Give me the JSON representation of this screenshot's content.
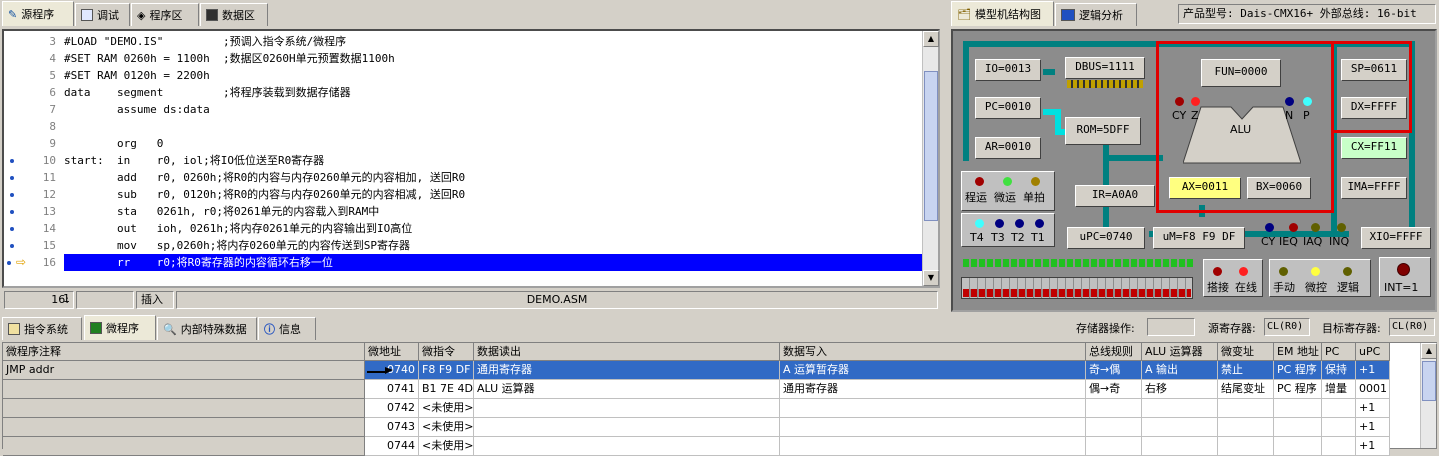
{
  "top_tabs": [
    "源程序",
    "调试",
    "程序区",
    "数据区"
  ],
  "right_tabs": [
    "模型机结构图",
    "逻辑分析"
  ],
  "product": "产品型号: Dais-CMX16+  外部总线: 16-bit",
  "editor": {
    "lines": [
      {
        "n": "3",
        "text": "#LOAD \"DEMO.IS\"         ;预调入指令系统/微程序",
        "marker": ""
      },
      {
        "n": "4",
        "text": "#SET RAM 0260h = 1100h  ;数据区0260H单元预置数据1100h",
        "marker": ""
      },
      {
        "n": "5",
        "text": "#SET RAM 0120h = 2200h",
        "marker": ""
      },
      {
        "n": "6",
        "text": "data    segment         ;将程序装载到数据存储器",
        "marker": ""
      },
      {
        "n": "7",
        "text": "        assume ds:data",
        "marker": ""
      },
      {
        "n": "8",
        "text": "",
        "marker": ""
      },
      {
        "n": "9",
        "text": "        org   0",
        "marker": ""
      },
      {
        "n": "10",
        "text": "start:  in    r0, iol;将IO低位送至R0寄存器",
        "marker": "dot"
      },
      {
        "n": "11",
        "text": "        add   r0, 0260h;将R0的内容与内存0260单元的内容相加, 送回R0",
        "marker": "dot"
      },
      {
        "n": "12",
        "text": "        sub   r0, 0120h;将R0的内容与内存0260单元的内容相减, 送回R0",
        "marker": "dot"
      },
      {
        "n": "13",
        "text": "        sta   0261h, r0;将0261单元的内容载入到RAM中",
        "marker": "dot"
      },
      {
        "n": "14",
        "text": "        out   ioh, 0261h;将内存0261单元的内容输出到IO高位",
        "marker": "dot"
      },
      {
        "n": "15",
        "text": "        mov   sp,0260h;将内存0260单元的内容传送到SP寄存器",
        "marker": "dot"
      },
      {
        "n": "16",
        "text": "        rr    r0;将R0寄存器的内容循环右移一位",
        "marker": "current"
      }
    ]
  },
  "status": {
    "pos1": "16:",
    "pos2": "1",
    "mode": "插入",
    "file": "DEMO.ASM"
  },
  "model": {
    "io": "IO=0013",
    "pc": "PC=0010",
    "ar": "AR=0010",
    "dbus": "DBUS=1111",
    "rom": "ROM=5DFF",
    "fun": "FUN=0000",
    "alu": "ALU",
    "ax": "AX=0011",
    "bx": "BX=0060",
    "ir": "IR=A0A0",
    "upc": "uPC=0740",
    "um": "uM=F8 F9 DF",
    "sp": "SP=0611",
    "dx": "DX=FFFF",
    "cx": "CX=FF11",
    "ima": "IMA=FFFF",
    "xio": "XIO=FFFF",
    "int": "INT=1",
    "flags_left": [
      "CY",
      "Z"
    ],
    "flags_right": [
      "N",
      "P"
    ],
    "run_labels": [
      "程运",
      "微运",
      "单拍"
    ],
    "t_labels": [
      "T4",
      "T3",
      "T2",
      "T1"
    ],
    "bottom_flags": [
      "CY",
      "IEQ",
      "IAQ",
      "INQ"
    ],
    "conn_labels": [
      "搭接",
      "在线"
    ],
    "mode_labels": [
      "手动",
      "微控",
      "逻辑"
    ]
  },
  "bottom_tabs": [
    "指令系统",
    "微程序",
    "内部特殊数据",
    "信息"
  ],
  "mem_ops": {
    "label": "存储器操作:",
    "src_label": "源寄存器:",
    "src": "CL(R0)",
    "dst_label": "目标寄存器:",
    "dst": "CL(R0)"
  },
  "grid": {
    "headers": [
      "微程序注释",
      "微地址",
      "微指令",
      "数据读出",
      "数据写入",
      "总线规则",
      "ALU 运算器",
      "微变址",
      "EM 地址",
      "PC",
      "uPC"
    ],
    "rows": [
      [
        "JMP addr",
        "0740",
        "F8 F9 DF",
        "通用寄存器",
        "A 运算暂存器",
        "奇→偶",
        "A 输出",
        "禁止",
        "PC 程序",
        "保持",
        "+1"
      ],
      [
        "",
        "0741",
        "B1 7E 4D",
        "ALU 运算器",
        "通用寄存器",
        "偶→奇",
        "右移",
        "结尾变址",
        "PC 程序",
        "增量",
        "0001"
      ],
      [
        "",
        "0742",
        "<未使用>",
        "",
        "",
        "",
        "",
        "",
        "",
        "",
        "+1"
      ],
      [
        "",
        "0743",
        "<未使用>",
        "",
        "",
        "",
        "",
        "",
        "",
        "",
        "+1"
      ],
      [
        "",
        "0744",
        "<未使用>",
        "",
        "",
        "",
        "",
        "",
        "",
        "",
        "+1"
      ]
    ]
  }
}
